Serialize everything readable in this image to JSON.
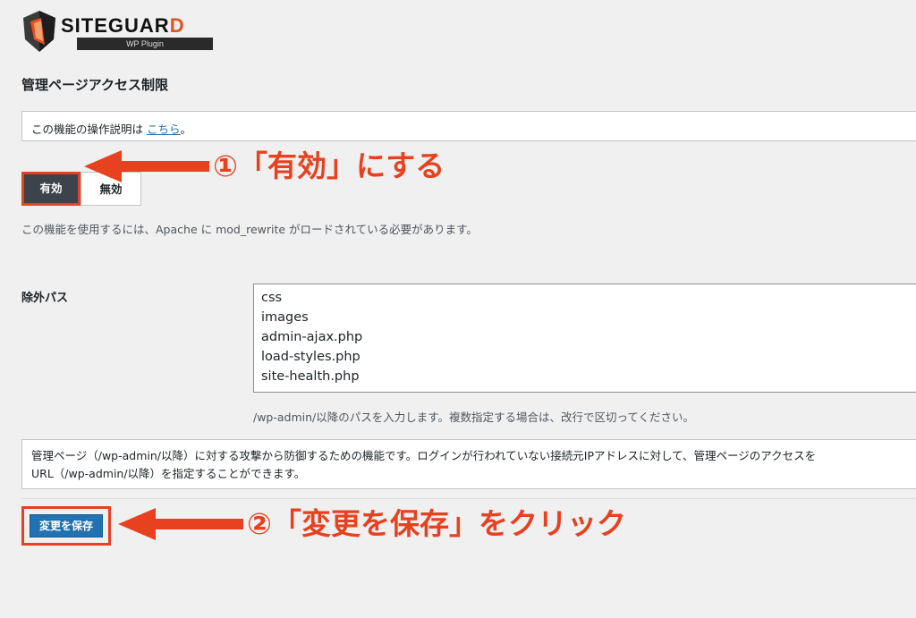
{
  "logo": {
    "brand_main": "SITEGUAR",
    "brand_last": "D",
    "sub": "WP Plugin"
  },
  "page": {
    "title": "管理ページアクセス制限"
  },
  "help": {
    "prefix": "この機能の操作説明は ",
    "link": "こちら",
    "suffix": "。"
  },
  "toggle": {
    "on_label": "有効",
    "off_label": "無効",
    "selected": "on"
  },
  "mod_note": "この機能を使用するには、Apache に mod_rewrite がロードされている必要があります。",
  "exclude": {
    "label": "除外パス",
    "value": "css\nimages\nadmin-ajax.php\nload-styles.php\nsite-health.php",
    "help": "/wp-admin/以降のパスを入力します。複数指定する場合は、改行で区切ってください。"
  },
  "description": {
    "line1": "管理ページ（/wp-admin/以降）に対する攻撃から防御するための機能です。ログインが行われていない接続元IPアドレスに対して、管理ページのアクセスを",
    "line2": "URL（/wp-admin/以降）を指定することができます。"
  },
  "save": {
    "label": "変更を保存"
  },
  "annotations": {
    "step1": "①「有効」にする",
    "step2": "②「変更を保存」をクリック",
    "color": "#e8411f"
  }
}
